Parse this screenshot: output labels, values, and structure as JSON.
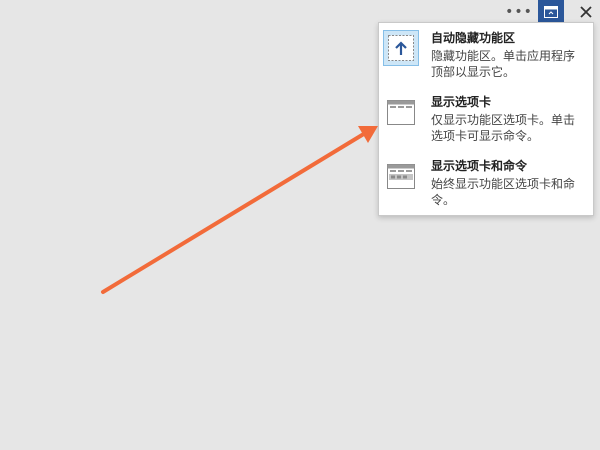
{
  "titlebar": {
    "more_label": "•••"
  },
  "ribbon_menu": {
    "items": [
      {
        "title": "自动隐藏功能区",
        "description": "隐藏功能区。单击应用程序顶部以显示它。",
        "icon": "auto-hide-ribbon-icon",
        "selected": true
      },
      {
        "title": "显示选项卡",
        "description": "仅显示功能区选项卡。单击选项卡可显示命令。",
        "icon": "show-tabs-icon",
        "selected": false
      },
      {
        "title": "显示选项卡和命令",
        "description": "始终显示功能区选项卡和命令。",
        "icon": "show-tabs-commands-icon",
        "selected": false
      }
    ]
  },
  "colors": {
    "accent": "#2b579a",
    "arrow": "#f26b3a",
    "background": "#e6e6e6",
    "selected_bg": "#cde6f7"
  }
}
